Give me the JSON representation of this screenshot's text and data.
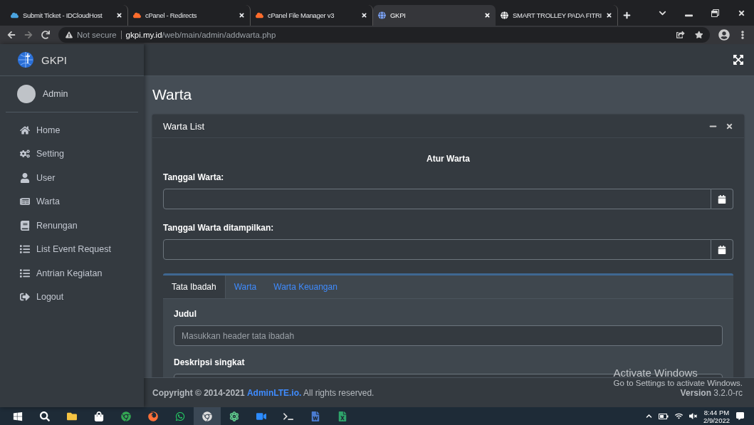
{
  "browser": {
    "tabs": [
      {
        "title": "Submit Ticket - IDCloudHost",
        "kind": "cloud",
        "selected": false
      },
      {
        "title": "cPanel - Redirects",
        "kind": "cpanel",
        "selected": false
      },
      {
        "title": "cPanel File Manager v3",
        "kind": "cpanel",
        "selected": false
      },
      {
        "title": "GKPI",
        "kind": "globe",
        "selected": true
      },
      {
        "title": "SMART TROLLEY PADA FITRI",
        "kind": "web",
        "selected": false
      }
    ],
    "address": {
      "security": "Not secure",
      "domain": "gkpi.my.id",
      "path": "/web/main/admin/addwarta.php"
    }
  },
  "sidebar": {
    "brand": "GKPI",
    "user": "Admin",
    "items": [
      {
        "label": "Home",
        "kind": "home"
      },
      {
        "label": "Setting",
        "kind": "cogs"
      },
      {
        "label": "User",
        "kind": "user"
      },
      {
        "label": "Warta",
        "kind": "news"
      },
      {
        "label": "Renungan",
        "kind": "book"
      },
      {
        "label": "List Event Request",
        "kind": "list"
      },
      {
        "label": "Antrian Kegiatan",
        "kind": "list"
      },
      {
        "label": "Logout",
        "kind": "logout"
      }
    ]
  },
  "content": {
    "title": "Warta",
    "card": {
      "title": "Warta List",
      "heading": "Atur Warta",
      "date_fields": [
        {
          "label": "Tanggal Warta:"
        },
        {
          "label": "Tanggal Warta ditampilkan:"
        }
      ],
      "tabs": [
        {
          "label": "Tata Ibadah",
          "selected": true
        },
        {
          "label": "Warta",
          "selected": false
        },
        {
          "label": "Warta Keuangan",
          "selected": false
        }
      ],
      "fields": [
        {
          "label": "Judul",
          "placeholder": "Masukkan header tata ibadah"
        },
        {
          "label": "Deskripsi singkat"
        }
      ]
    }
  },
  "footer": {
    "copyright": "Copyright © 2014-2021",
    "link": "AdminLTE.io.",
    "rights": "All rights reserved.",
    "version_label": "Version",
    "version": "3.2.0-rc"
  },
  "activation": {
    "title": "Activate Windows",
    "subtitle": "Go to Settings to activate Windows."
  },
  "taskbar": {
    "time": "8:44 PM",
    "date": "2/9/2022"
  }
}
